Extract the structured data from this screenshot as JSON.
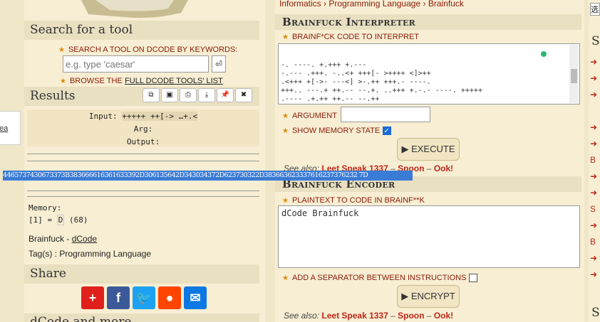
{
  "left": {
    "search_title": "Search for a tool",
    "search_keywords_label": "SEARCH A TOOL ON DCODE BY KEYWORDS:",
    "search_placeholder": "e.g. type 'caesar'",
    "browse_prefix": "BROWSE THE",
    "browse_link": "FULL DCODE TOOLS' LIST",
    "results_title": "Results",
    "tool_icons": [
      "copy-icon",
      "save-icon",
      "print-icon",
      "download-icon",
      "pin-icon",
      "close-icon"
    ],
    "input_label": "Input:",
    "input_value": "+++++ ++[-> …+.<",
    "arg_label": "Arg:",
    "output_label": "Output:",
    "hex_output": "4465737430673373B383666616361633392D306135642D343034372D623730322D383663623337616237376232 7D",
    "memory_label": "Memory:",
    "memory_cell": "[1] =",
    "memory_char": "D",
    "memory_code": "(68)",
    "credit_name": "Brainfuck",
    "credit_sep": " - ",
    "credit_link": "dCode",
    "tags_label": "Tag(s) : Programming Language",
    "share_title": "Share",
    "more_title": "dCode and more",
    "edge_link": "ea"
  },
  "breadcrumb": {
    "item1": "Informatics",
    "sep": "›",
    "item2": "Programming Language",
    "item3": "Brainfuck"
  },
  "interpreter": {
    "title": "Brainfuck Interpreter",
    "code_label": "BRAINF*CK CODE TO INTERPRET",
    "code_lines": [
      "-. ----. +.+++ +.---",
      "-.--- .+++. -..<+ +++[- >++++ <]>++",
      ".<+++ +[->- ---<] >-.++ +++.- ----.",
      "+++.. ---.+ ++.-- --.+. ..+++ +.-.- ----. +++++",
      ".---- .+.++ ++.-- --.++",
      "++.-. ----. +.-.+ ++++.",
      "<+++[ ->+++ <]>++ ++.<"
    ],
    "argument_label": "ARGUMENT",
    "show_memory_label": "SHOW MEMORY STATE",
    "execute_label": "▶ EXECUTE",
    "see_also_label": "See also:",
    "see_also_1": "Leet Speak 1337",
    "see_also_2": "Spoon",
    "see_also_3": "Ook!",
    "dash": " – "
  },
  "encoder": {
    "title": "Brainfuck Encoder",
    "plaintext_label": "PLAINTEXT TO CODE IN BRAINF**K",
    "plaintext_value": "dCode Brainfuck",
    "separator_label": "ADD A SEPARATOR BETWEEN INSTRUCTIONS",
    "encrypt_label": "▶ ENCRYPT",
    "see_also_label": "See also:",
    "see_also_1": "Leet Speak 1337",
    "see_also_2": "Spoon",
    "see_also_3": "Ook!",
    "dash": " – "
  },
  "right": {
    "top_char": "选",
    "s1": "S",
    "items": [
      "➜",
      "➜",
      "➜ (D",
      "",
      "➜ B",
      "➜",
      "B",
      "➜ co",
      "➜",
      "S",
      "➜",
      "B",
      "➜ th",
      "➜ im"
    ],
    "s2": "S"
  },
  "colors": {
    "page_bg": "#f0e7c9",
    "panel_bg": "#f7eed3",
    "title_bg": "#e9dfc1",
    "link_red": "#c0261a",
    "highlight_blue": "#3a7bd5"
  }
}
